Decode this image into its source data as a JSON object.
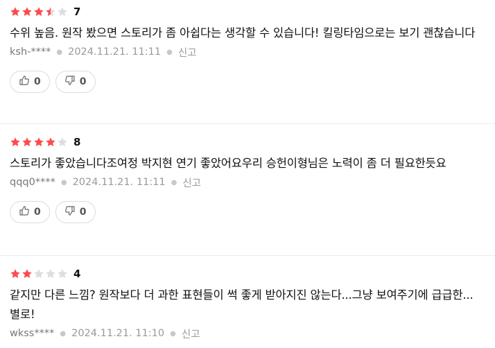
{
  "reviews": [
    {
      "rating": 3.5,
      "score": "7",
      "content": "수위 높음. 원작 봤으면 스토리가 좀 아쉽다는 생각할 수 있습니다! 킬링타임으로는 보기 괜찮습니다",
      "user": "ksh-****",
      "date": "2024.11.21. 11:11",
      "report": "신고",
      "likes": "0",
      "dislikes": "0"
    },
    {
      "rating": 4,
      "score": "8",
      "content": "스토리가 좋았습니다조여정 박지현 연기 좋았어요우리 승헌이형님은 노력이 좀 더 필요한듯요",
      "user": "qqq0****",
      "date": "2024.11.21. 11:11",
      "report": "신고",
      "likes": "0",
      "dislikes": "0"
    },
    {
      "rating": 2,
      "score": "4",
      "content": "같지만 다른 느낌? 원작보다 더 과한 표현들이 썩 좋게 받아지진 않는다...그냥 보여주기에 급급한...별로!",
      "user": "wkss****",
      "date": "2024.11.21. 11:10",
      "report": "신고",
      "likes": "0",
      "dislikes": "0"
    }
  ],
  "colors": {
    "star_on": "#fc4c4e",
    "star_off": "#dddddd"
  },
  "icons": {
    "like": "thumbs-up-icon",
    "dislike": "thumbs-down-icon",
    "star": "star-icon"
  }
}
